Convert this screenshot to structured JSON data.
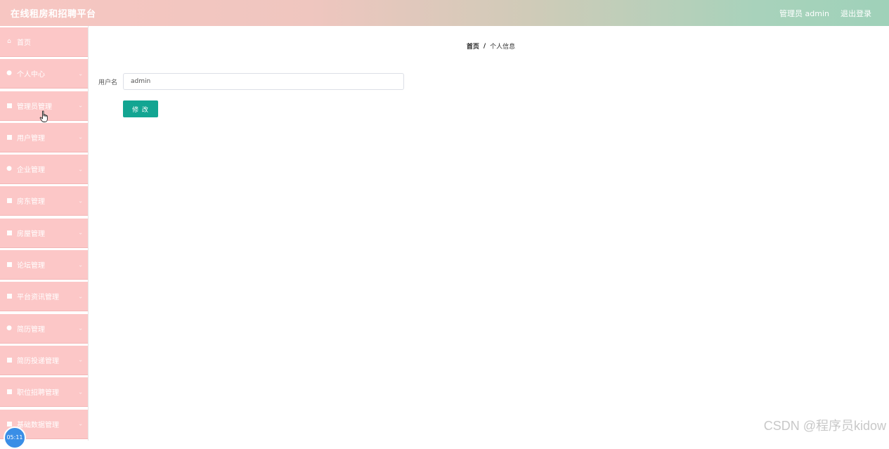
{
  "header": {
    "app_title": "在线租房和招聘平台",
    "admin_label": "管理员 admin",
    "logout_label": "退出登录"
  },
  "sidebar": {
    "items": [
      {
        "label": "首页",
        "icon": "home-icon"
      },
      {
        "label": "个人中心",
        "icon": "user-icon"
      },
      {
        "label": "管理员管理",
        "icon": "menu-icon"
      },
      {
        "label": "用户管理",
        "icon": "menu-icon"
      },
      {
        "label": "企业管理",
        "icon": "location-icon"
      },
      {
        "label": "房东管理",
        "icon": "menu-icon"
      },
      {
        "label": "房屋管理",
        "icon": "menu-icon"
      },
      {
        "label": "论坛管理",
        "icon": "menu-icon"
      },
      {
        "label": "平台资讯管理",
        "icon": "menu-icon"
      },
      {
        "label": "简历管理",
        "icon": "user-icon"
      },
      {
        "label": "简历投递管理",
        "icon": "menu-icon"
      },
      {
        "label": "职位招聘管理",
        "icon": "menu-icon"
      },
      {
        "label": "基础数据管理",
        "icon": "menu-icon"
      }
    ]
  },
  "breadcrumb": {
    "home": "首页",
    "separator": "/",
    "current": "个人信息"
  },
  "form": {
    "username_label": "用户名",
    "username_value": "admin",
    "submit_label": "修 改"
  },
  "timer": {
    "text": "05:11"
  },
  "watermark": {
    "text": "CSDN @程序员kidow"
  },
  "colors": {
    "sidebar_item_bg": "#fcc7c7",
    "button_bg": "#13a592",
    "header_gradient_start": "#f7c6c2",
    "header_gradient_end": "#9fd1b9"
  }
}
